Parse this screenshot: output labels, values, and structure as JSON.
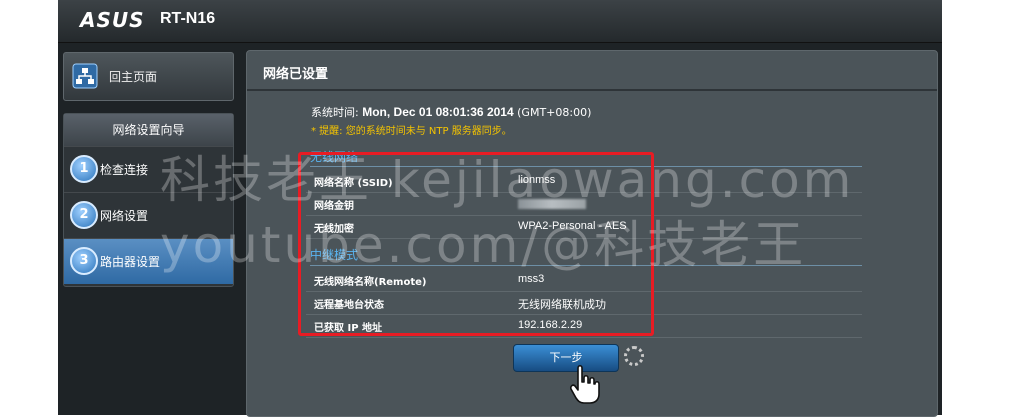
{
  "header": {
    "brand": "ASUS",
    "model": "RT-N16"
  },
  "sidebar": {
    "home_label": "回主页面",
    "wizard_title": "网络设置向导",
    "steps": [
      {
        "num": "1",
        "label": "检查连接"
      },
      {
        "num": "2",
        "label": "网络设置"
      },
      {
        "num": "3",
        "label": "路由器设置"
      }
    ]
  },
  "panel": {
    "title": "网络已设置",
    "system_time_label": "系统时间:",
    "system_time_value": "Mon, Dec 01 08:01:36 2014",
    "timezone": "(GMT+08:00)",
    "ntp_warning": "* 提醒: 您的系统时间未与 NTP 服务器同步。",
    "wireless_section": "无线网络",
    "wireless_rows": [
      {
        "key": "网络名称 (SSID)",
        "value": "lionmss"
      },
      {
        "key": "网络金钥",
        "value": ""
      },
      {
        "key": "无线加密",
        "value": "WPA2-Personal - AES"
      }
    ],
    "repeater_section": "中继模式",
    "repeater_rows": [
      {
        "key": "无线网络名称(Remote)",
        "value": "mss3"
      },
      {
        "key": "远程基地台状态",
        "value": "无线网络联机成功"
      },
      {
        "key": "已获取 IP 地址",
        "value": "192.168.2.29"
      }
    ],
    "next_button": "下一步"
  },
  "watermark": {
    "line1": "科技老王 kejilaowang.com",
    "line2": "youtube.com/@科技老王"
  },
  "colors": {
    "highlight": "#e81c24",
    "section_blue": "#5ab4f0",
    "warning": "#f5c400"
  }
}
